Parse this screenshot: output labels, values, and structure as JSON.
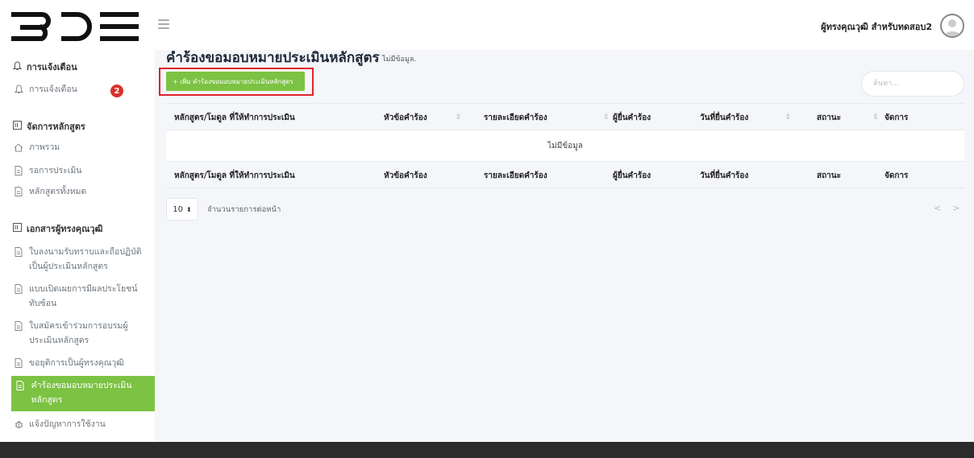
{
  "header": {
    "logo_text": "BDE",
    "user_name": "ผู้ทรงคุณวุฒิ สำหรับทดสอบ2"
  },
  "sidebar": {
    "sections": [
      {
        "title": "การแจ้งเตือน"
      },
      {
        "title": "จัดการหลักสูตร"
      },
      {
        "title": "เอกสารผู้ทรงคุณวุฒิ"
      }
    ],
    "items": [
      {
        "label": "การแจ้งเตือน",
        "icon": "bell-icon",
        "badge": "2"
      },
      {
        "label": "ภาพรวม",
        "icon": "home-icon"
      },
      {
        "label": "รอการประเมิน",
        "icon": "document-icon"
      },
      {
        "label": "หลักสูตรทั้งหมด",
        "icon": "document-icon"
      },
      {
        "label": "ใบลงนามรับทราบและถือปฏิบัติเป็นผู้ประเมินหลักสูตร",
        "icon": "document-icon"
      },
      {
        "label": "แบบเปิดเผยการมีผลประโยชน์ทับซ้อน",
        "icon": "document-icon"
      },
      {
        "label": "ใบสมัครเข้าร่วมการอบรมผู้ประเมินหลักสูตร",
        "icon": "document-icon"
      },
      {
        "label": "ขอยุติการเป็นผู้ทรงคุณวุฒิ",
        "icon": "document-icon"
      },
      {
        "label": "คำร้องขอมอบหมายประเมินหลักสูตร",
        "icon": "document-icon",
        "active": true
      },
      {
        "label": "แจ้งปัญหาการใช้งาน",
        "icon": "bug-icon"
      }
    ]
  },
  "main": {
    "title": "คำร้องขอมอบหมายประเมินหลักสูตร",
    "subtitle": "ไม่มีข้อมูล.",
    "add_button": "+ เพิ่ม คำร้องขอมอบหมายประเมินหลักสูตร",
    "search_placeholder": "ค้นหา...",
    "table": {
      "columns": [
        "หลักสูตร/โมดูล ที่ให้ทำการประเมิน",
        "หัวข้อคำร้อง",
        "รายละเอียดคำร้อง",
        "ผู้ยื่นคำร้อง",
        "วันที่ยื่นคำร้อง",
        "สถานะ",
        "จัดการ"
      ],
      "empty_text": "ไม่มีข้อมูล"
    },
    "page_size": "10",
    "page_size_label": "จำนวนรายการต่อหน้า",
    "pager_prev": "<",
    "pager_next": ">"
  },
  "colors": {
    "accent_green": "#7cc243",
    "highlight_red": "#e0232b",
    "badge_red": "#d9302c",
    "footer_dark": "#2b2b2b"
  }
}
